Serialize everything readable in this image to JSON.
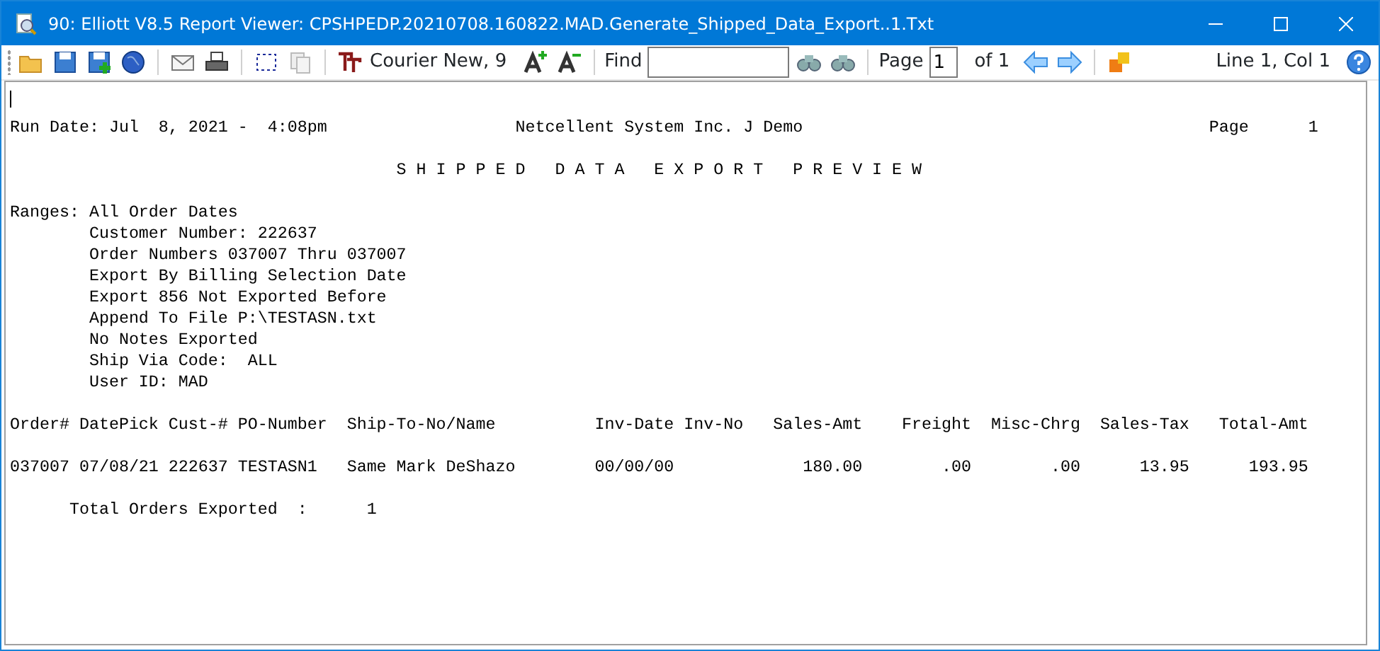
{
  "window": {
    "title": "90: Elliott V8.5 Report Viewer: CPSHPEDP.20210708.160822.MAD.Generate_Shipped_Data_Export..1.Txt"
  },
  "toolbar": {
    "copy_button": {
      "disabled": true
    },
    "font_label": "Courier New, 9",
    "find_label": "Find",
    "page_label": "Page",
    "page_value": "1",
    "page_total": "of 1",
    "position": "Line 1, Col 1"
  },
  "report": {
    "blocks": [
      [
        "Run Date: Jul  8, 2021 -  4:08pm                   Netcellent System Inc. J Demo                                         Page      1"
      ],
      [
        "                                       S H I P P E D   D A T A   E X P O R T   P R E V I E W"
      ],
      [
        "Ranges: All Order Dates",
        "        Customer Number: 222637",
        "        Order Numbers 037007 Thru 037007",
        "        Export By Billing Selection Date",
        "        Export 856 Not Exported Before",
        "        Append To File P:\\TESTASN.txt",
        "        No Notes Exported",
        "        Ship Via Code:  ALL",
        "        User ID: MAD"
      ],
      [
        "Order# DatePick Cust-# PO-Number  Ship-To-No/Name          Inv-Date Inv-No   Sales-Amt    Freight  Misc-Chrg  Sales-Tax   Total-Amt"
      ],
      [
        "037007 07/08/21 222637 TESTASN1   Same Mark DeShazo        00/00/00             180.00        .00        .00      13.95      193.95"
      ],
      [
        "      Total Orders Exported  :      1"
      ]
    ]
  }
}
